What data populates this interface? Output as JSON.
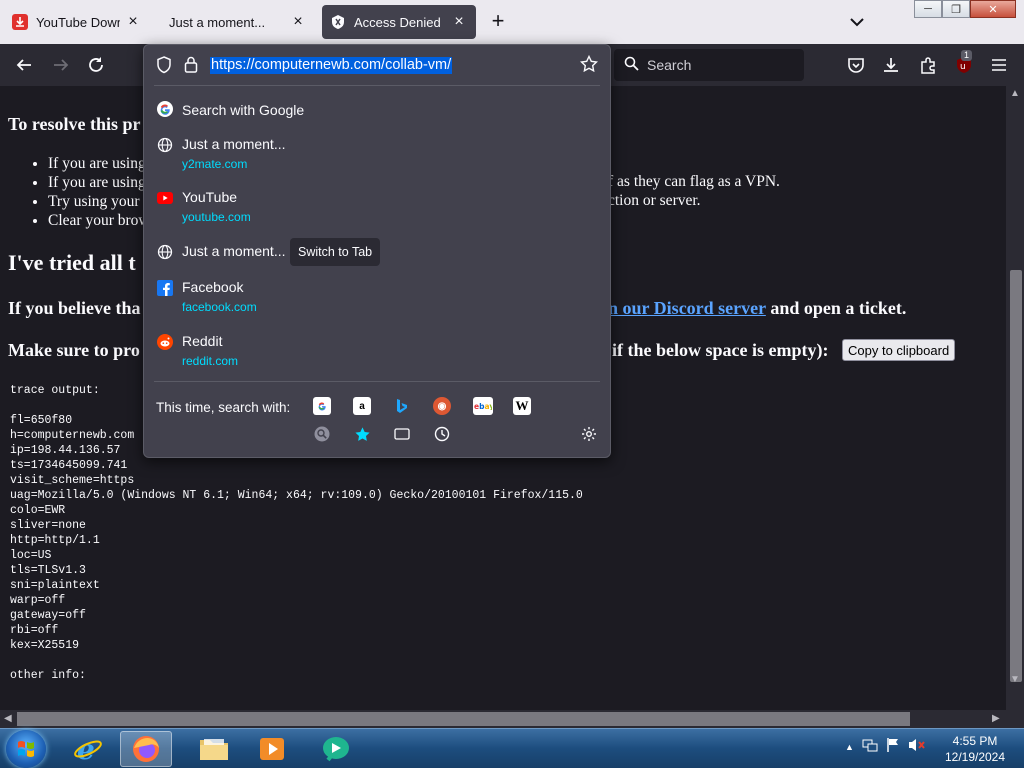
{
  "tabs": [
    {
      "label": "YouTube Downloader",
      "active": false
    },
    {
      "label": "Just a moment...",
      "active": false
    },
    {
      "label": "Access Denied",
      "active": true
    }
  ],
  "navbar": {
    "search_placeholder": "Search",
    "extension_badge": "1"
  },
  "urlbar": {
    "url": "https://computernewb.com/collab-vm/"
  },
  "suggestions": [
    {
      "title": "Search with Google",
      "subtitle": "",
      "icon": "google-icon"
    },
    {
      "title": "Just a moment...",
      "subtitle": "y2mate.com",
      "icon": "globe-icon"
    },
    {
      "title": "YouTube",
      "subtitle": "youtube.com",
      "icon": "youtube-icon"
    },
    {
      "title": "Just a moment...",
      "subtitle": "",
      "icon": "globe-icon",
      "action": "Switch to Tab"
    },
    {
      "title": "Facebook",
      "subtitle": "facebook.com",
      "icon": "facebook-icon"
    },
    {
      "title": "Reddit",
      "subtitle": "reddit.com",
      "icon": "reddit-icon"
    }
  ],
  "one_off": {
    "label": "This time, search with:",
    "engines": [
      "google-icon",
      "amazon-icon",
      "bing-icon",
      "duckduckgo-icon",
      "ebay-icon",
      "wikipedia-icon"
    ],
    "modes": [
      "search-icon",
      "bookmarks-star-icon",
      "tabs-icon",
      "history-clock-icon"
    ]
  },
  "page": {
    "resolve_heading": "To resolve this pr",
    "bullets_left": [
      "If you are using",
      "If you are using",
      "Try using your",
      "Clear your brow"
    ],
    "bullets_right": [
      "f as they can flag as a VPN.",
      "ction or server."
    ],
    "tried_heading": "I've tried all t",
    "believe_left": "If you believe tha",
    "discord_link": "n our Discord server",
    "believe_right": " and open a ticket.",
    "make_sure_left": "Make sure to pro",
    "make_sure_right": "if the below space is empty):",
    "copy_button": "Copy to clipboard",
    "trace_text": "trace output:\n\nfl=650f80\nh=computernewb.com\nip=198.44.136.57\nts=1734645099.741\nvisit_scheme=https\nuag=Mozilla/5.0 (Windows NT 6.1; Win64; x64; rv:109.0) Gecko/20100101 Firefox/115.0\ncolo=EWR\nsliver=none\nhttp=http/1.1\nloc=US\ntls=TLSv1.3\nsni=plaintext\nwarp=off\ngateway=off\nrbi=off\nkex=X25519\n\nother info:"
  },
  "clock": {
    "time": "4:55 PM",
    "date": "12/19/2024"
  }
}
